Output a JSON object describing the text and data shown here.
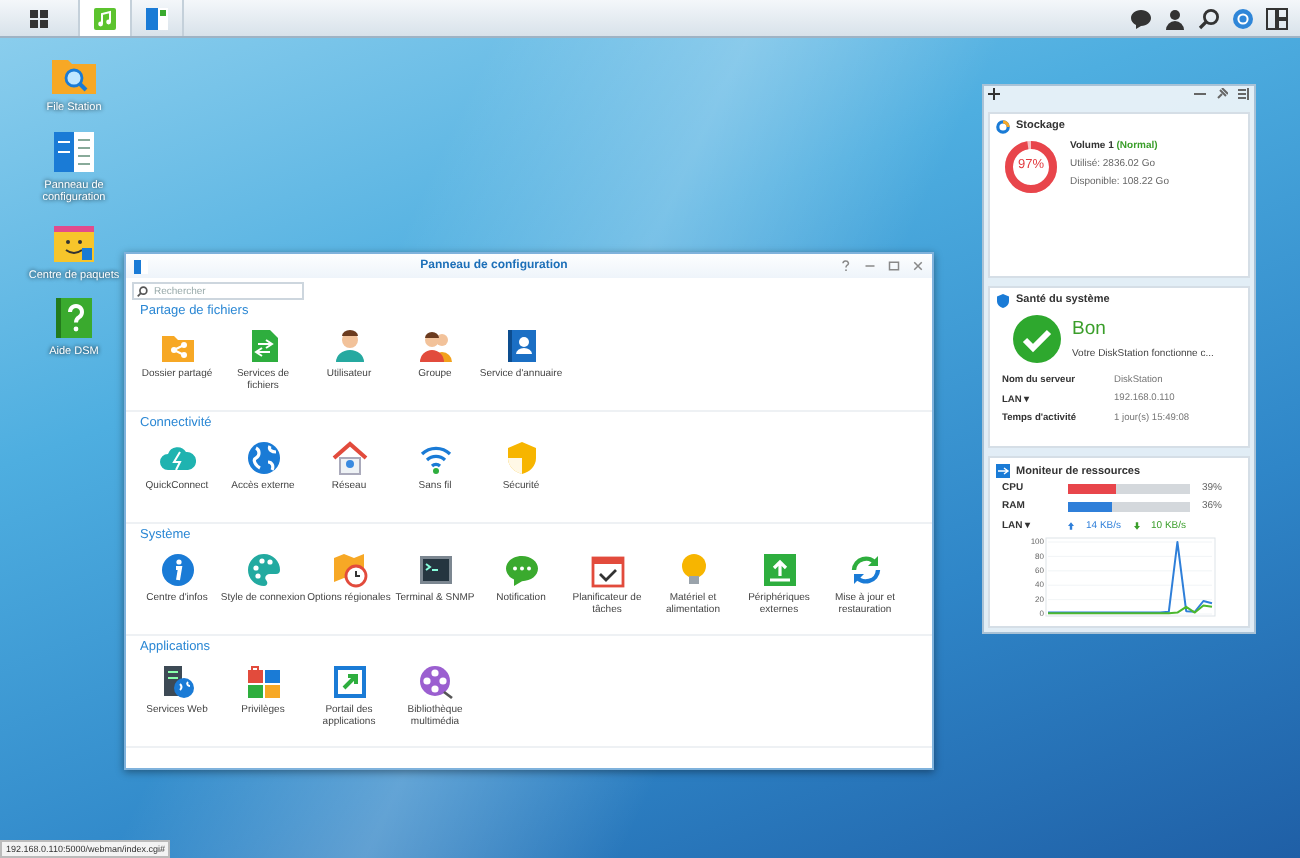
{
  "taskbar": {
    "apps": [
      {
        "kind": "main-menu",
        "selected": false
      },
      {
        "kind": "package",
        "selected": true
      },
      {
        "kind": "control-panel",
        "selected": false
      }
    ]
  },
  "desktop_icons": [
    {
      "label": "File Station",
      "kind": "file-station"
    },
    {
      "label": "Panneau de configuration",
      "kind": "control-panel"
    },
    {
      "label": "Centre de paquets",
      "kind": "package-center"
    },
    {
      "label": "Aide DSM",
      "kind": "help"
    }
  ],
  "control_panel": {
    "title": "Panneau de configuration",
    "search": {
      "placeholder": "Rechercher"
    },
    "sections": [
      {
        "title": "Partage de fichiers",
        "items": [
          {
            "label": "Dossier partagé",
            "kind": "shared-folder"
          },
          {
            "label": "Services de fichiers",
            "kind": "file-services"
          },
          {
            "label": "Utilisateur",
            "kind": "user"
          },
          {
            "label": "Groupe",
            "kind": "group"
          },
          {
            "label": "Service d'annuaire",
            "kind": "directory"
          }
        ]
      },
      {
        "title": "Connectivité",
        "items": [
          {
            "label": "QuickConnect",
            "kind": "quickconnect"
          },
          {
            "label": "Accès externe",
            "kind": "external-access"
          },
          {
            "label": "Réseau",
            "kind": "network"
          },
          {
            "label": "Sans fil",
            "kind": "wireless"
          },
          {
            "label": "Sécurité",
            "kind": "security"
          }
        ]
      },
      {
        "title": "Système",
        "items": [
          {
            "label": "Centre d'infos",
            "kind": "info"
          },
          {
            "label": "Style de connexion",
            "kind": "theme"
          },
          {
            "label": "Options régionales",
            "kind": "regional"
          },
          {
            "label": "Terminal & SNMP",
            "kind": "terminal"
          },
          {
            "label": "Notification",
            "kind": "notification"
          },
          {
            "label": "Planificateur de tâches",
            "kind": "scheduler"
          },
          {
            "label": "Matériel et alimentation",
            "kind": "hardware"
          },
          {
            "label": "Périphériques externes",
            "kind": "external-devices"
          },
          {
            "label": "Mise à jour et restauration",
            "kind": "update"
          }
        ]
      },
      {
        "title": "Applications",
        "items": [
          {
            "label": "Services Web",
            "kind": "web-services"
          },
          {
            "label": "Privilèges",
            "kind": "privileges"
          },
          {
            "label": "Portail des applications",
            "kind": "app-portal"
          },
          {
            "label": "Bibliothèque multimédia",
            "kind": "media-library"
          }
        ]
      }
    ]
  },
  "widgets": {
    "storage": {
      "title": "Stockage",
      "volume": "Volume 1",
      "status": "(Normal)",
      "used": "Utilisé: 2836.02 Go",
      "available": "Disponible: 108.22 Go",
      "usage": "97%",
      "level": 0.97
    },
    "health": {
      "title": "Santé du système",
      "status": "Bon",
      "message": "Votre DiskStation fonctionne c...",
      "rows": [
        {
          "label": "Nom du serveur",
          "value": "DiskStation"
        },
        {
          "label": "LAN ▾",
          "value": "192.168.0.110"
        },
        {
          "label": "Temps d'activité",
          "value": "1 jour(s) 15:49:08"
        }
      ]
    },
    "monitor": {
      "title": "Moniteur de ressources",
      "meters": [
        {
          "name": "CPU",
          "level": 0.39,
          "reading": "39%",
          "color": "#e8454b"
        },
        {
          "name": "RAM",
          "level": 0.36,
          "reading": "36%",
          "color": "#2f7fd9"
        }
      ],
      "lan": {
        "label": "LAN ▾",
        "upload": "14 KB/s",
        "download": "10 KB/s"
      },
      "chart_data": {
        "type": "line",
        "grid": true,
        "ylim": [
          0,
          100
        ],
        "yticks": [
          0,
          20,
          40,
          60,
          80,
          100
        ],
        "series": [
          {
            "color": "#2f7fd9",
            "values": [
              2,
              2,
              2,
              2,
              2,
              2,
              2,
              2,
              2,
              2,
              2,
              2,
              2,
              2,
              3,
              100,
              4,
              3,
              18,
              15
            ]
          },
          {
            "color": "#4cb82e",
            "values": [
              1,
              1,
              1,
              1,
              1,
              1,
              1,
              1,
              1,
              1,
              1,
              1,
              1,
              1,
              1,
              2,
              10,
              2,
              12,
              10
            ]
          }
        ]
      }
    }
  },
  "status_url": "192.168.0.110:5000/webman/index.cgi#"
}
